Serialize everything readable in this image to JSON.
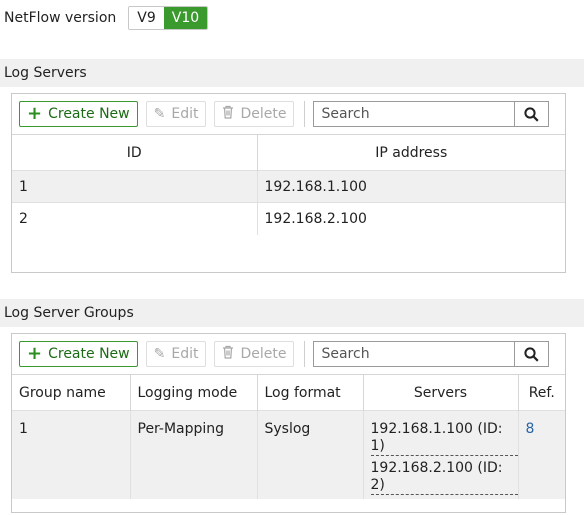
{
  "netflow": {
    "label": "NetFlow version",
    "options": [
      "V9",
      "V10"
    ],
    "selected": "V10"
  },
  "log_servers": {
    "title": "Log Servers",
    "toolbar": {
      "create": "Create New",
      "edit": "Edit",
      "delete": "Delete",
      "search_placeholder": "Search"
    },
    "columns": [
      "ID",
      "IP address"
    ],
    "rows": [
      {
        "id": "1",
        "ip": "192.168.1.100"
      },
      {
        "id": "2",
        "ip": "192.168.2.100"
      }
    ]
  },
  "log_server_groups": {
    "title": "Log Server Groups",
    "toolbar": {
      "create": "Create New",
      "edit": "Edit",
      "delete": "Delete",
      "search_placeholder": "Search"
    },
    "columns": [
      "Group name",
      "Logging mode",
      "Log format",
      "Servers",
      "Ref."
    ],
    "rows": [
      {
        "name": "1",
        "mode": "Per-Mapping",
        "format": "Syslog",
        "servers": [
          "192.168.1.100 (ID: 1)",
          "192.168.2.100 (ID: 2)"
        ],
        "ref": "8"
      }
    ]
  },
  "colors": {
    "accent": "#3a9a2e",
    "link": "#2b64a3"
  }
}
